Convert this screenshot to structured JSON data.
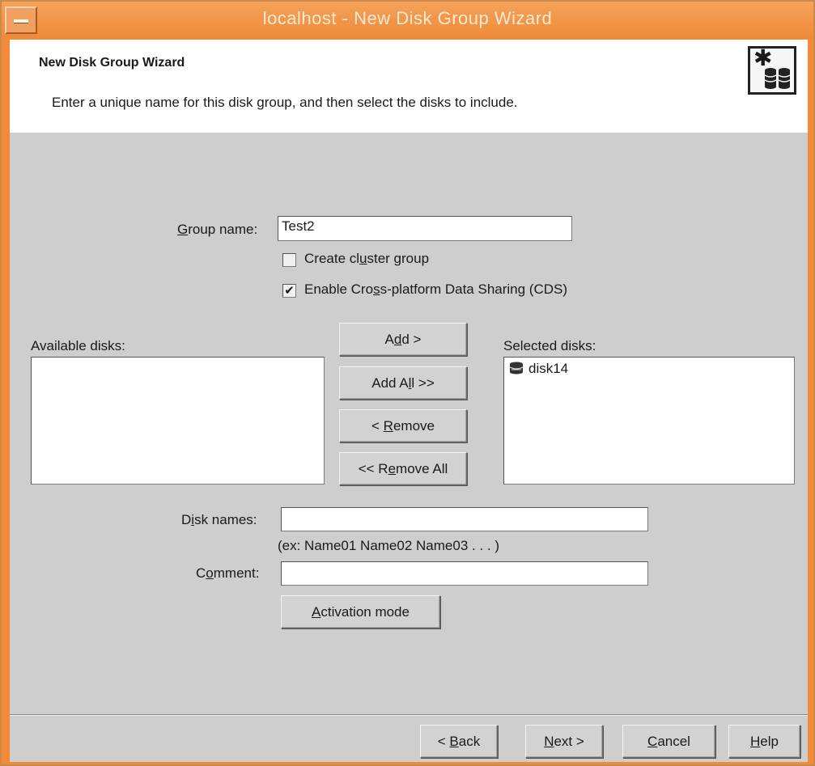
{
  "window": {
    "title": "localhost - New Disk Group Wizard"
  },
  "header": {
    "title": "New Disk Group Wizard",
    "description": "Enter a unique name for this disk group, and then select the disks to include.",
    "icon": "disk-group-wizard-icon"
  },
  "form": {
    "group_name": {
      "label_pre": "",
      "label_mnemonic": "G",
      "label_post": "roup name:",
      "value": "Test2"
    },
    "create_cluster": {
      "label_pre": "Create cl",
      "label_mnemonic": "u",
      "label_post": "ster group",
      "checked": false
    },
    "enable_cds": {
      "label_pre": "Enable Cro",
      "label_mnemonic": "s",
      "label_post": "s-platform Data Sharing (CDS)",
      "checked": true
    },
    "available_disks_label": "Available disks:",
    "available_disks": [],
    "selected_disks_label": "Selected disks:",
    "selected_disks": [
      "disk14"
    ],
    "add_button": {
      "pre": "A",
      "mn": "d",
      "post": "d >"
    },
    "add_all_button": {
      "pre": "Add A",
      "mn": "l",
      "post": "l >>"
    },
    "remove_button": {
      "pre": "< ",
      "mn": "R",
      "post": "emove"
    },
    "remove_all_button": {
      "pre": "<< R",
      "mn": "e",
      "post": "move All"
    },
    "disk_names": {
      "label_pre": "D",
      "label_mnemonic": "i",
      "label_post": "sk names:",
      "value": "",
      "hint": "(ex: Name01  Name02  Name03  . . . )"
    },
    "comment": {
      "label_pre": "C",
      "label_mnemonic": "o",
      "label_post": "mment:",
      "value": ""
    },
    "activation_mode_button": {
      "pre": "",
      "mn": "A",
      "post": "ctivation mode"
    }
  },
  "footer": {
    "back": {
      "pre": "< ",
      "mn": "B",
      "post": "ack"
    },
    "next": {
      "pre": "",
      "mn": "N",
      "post": "ext >"
    },
    "cancel": {
      "pre": "",
      "mn": "C",
      "post": "ancel"
    },
    "help": {
      "pre": "",
      "mn": "H",
      "post": "elp"
    }
  }
}
